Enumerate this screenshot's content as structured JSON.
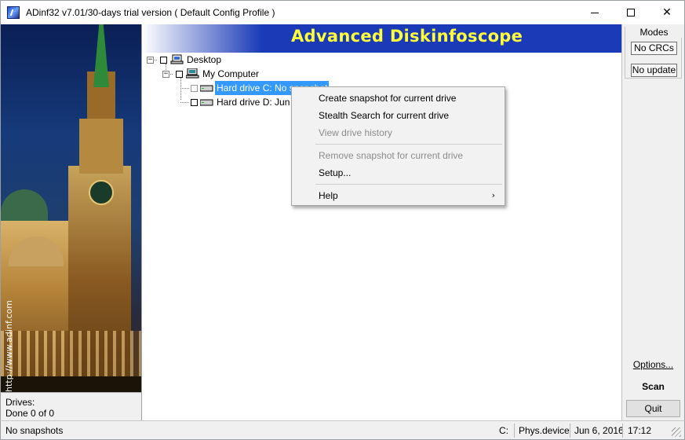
{
  "window": {
    "title": "ADinf32 v7.01/30-days trial version ( Default Config Profile )",
    "app_icon": "adinf-app-icon",
    "controls": {
      "minimize": "minimize-icon",
      "maximize": "maximize-icon",
      "close": "✕"
    }
  },
  "left_panel": {
    "vertical_url": "http://www.adinf.com",
    "drives_label": "Drives:",
    "drives_count": "Done  0 of  0"
  },
  "banner": {
    "text": "Advanced Diskinfoscope"
  },
  "tree": {
    "desktop_label": "Desktop",
    "computer_label": "My Computer",
    "drive_c_label": "Hard drive C: No snapshot",
    "drive_d_label": "Hard drive D: Jun 6"
  },
  "context_menu": {
    "items": [
      {
        "label": "Create snapshot for current drive",
        "enabled": true
      },
      {
        "label": "Stealth Search for current drive",
        "enabled": true
      },
      {
        "label": "View drive history",
        "enabled": false
      },
      {
        "label": "Remove snapshot for current drive",
        "enabled": false
      },
      {
        "label": "Setup...",
        "enabled": true
      },
      {
        "label": "Help",
        "enabled": true,
        "submenu_arrow": "›"
      }
    ]
  },
  "right_panel": {
    "modes_title": "Modes",
    "no_crcs": "No CRCs",
    "no_update": "No update",
    "options": "Options...",
    "scan": "Scan",
    "quit": "Quit"
  },
  "statusbar": {
    "message": "No snapshots",
    "drive": "C:",
    "access": "Phys.device",
    "date": "Jun 6, 2016",
    "time": "17:12"
  }
}
